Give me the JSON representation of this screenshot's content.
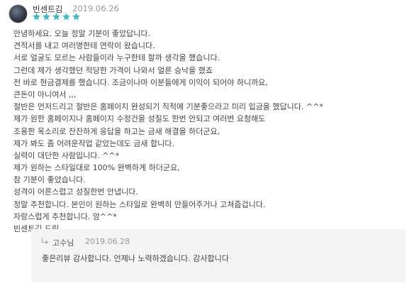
{
  "review": {
    "author": "빈센트김",
    "date": "2019.06.26",
    "rating": 5,
    "rating_max": 5,
    "star_color": "#3db8c5",
    "avatar_icon": "user-avatar",
    "body_lines": [
      "안녕하세요. 오늘 정말 기분이 좋았답니다.",
      "견적서를 내고 여러명한테 연락이 왔습니다.",
      "서로 얼굴도 모르는 사람들이라 누구한테 할까 생각을 했습니다.",
      "그런데 제가 생각했던 적당한 가격이 나와서 얼른 승낙을 했죠",
      "전 바로 현금결제를 했습니다. 조금이나마 이분들에게 이익이 되어야 하니까요,",
      "큰돈이 아니여서 ,,,",
      "절반은 먼저드리고 절반은 홈페이지 완성되기 직적에 기분좋으라고 미리 입금을 했답니다. ^^*",
      "제가 원한 홈페이지나 홈페이지 수정건을 성질도 한번 안되고 여러번 요청해도",
      "조용한 목소리로 잔잔하게 응답을 하고는 금새 해결을 하더군요,",
      "제가 봐도 좀 어려운작업 같았는데도 금새 합니다.",
      "실력이 대단한 사람입니다. ^^*",
      "제가 원하는 스타일대로 100% 완벽하게 하더군요,",
      "참 기분이 좋았습니다.",
      "성격이 어른스럽고 성질한번 안냅니다.",
      "정말 추천합니다. 본인이 원하는 스타일로 완벽히 만들어주거나 고쳐줍겁니다.",
      "자랑스럽게 추천합니다. 앙^^*",
      "빈센트김 드림"
    ]
  },
  "reply": {
    "arrow_icon": "reply-arrow",
    "author": "고수님",
    "date": "2019.06.28",
    "text": "좋은리뷰 감사합니다. 언제나 노력하겠습니다. 감사합니다"
  }
}
